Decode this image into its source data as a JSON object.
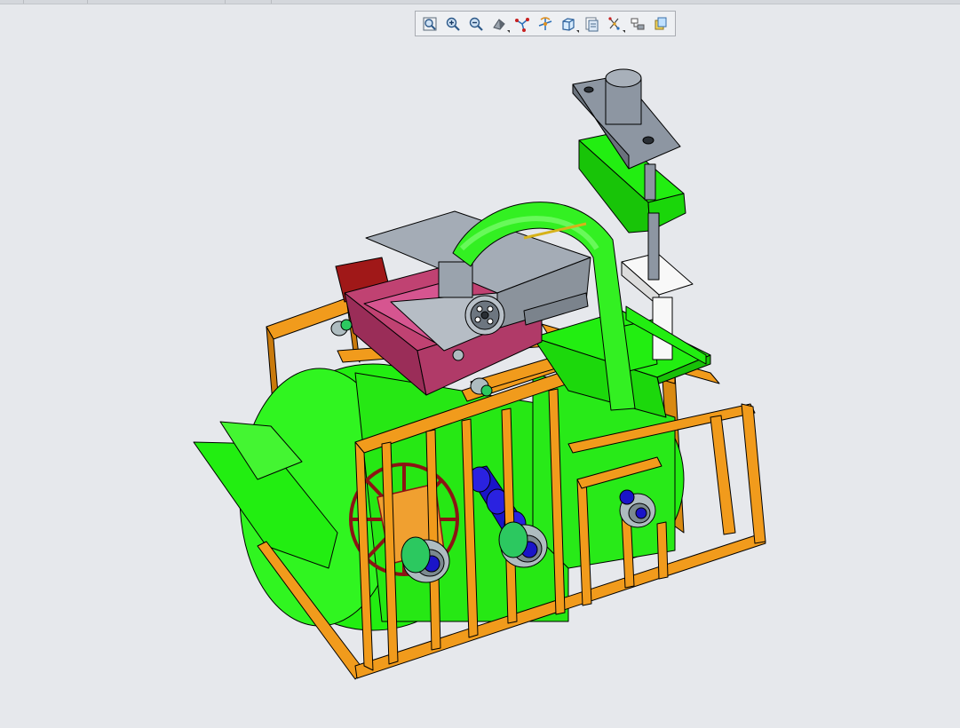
{
  "toolbar": {
    "buttons": [
      {
        "icon": "refit-icon"
      },
      {
        "icon": "zoom-in-icon"
      },
      {
        "icon": "zoom-out-icon"
      },
      {
        "icon": "display-style-icon"
      },
      {
        "icon": "datum-display-icon"
      },
      {
        "icon": "spin-center-icon"
      },
      {
        "icon": "saved-views-icon"
      },
      {
        "icon": "named-views-icon"
      },
      {
        "icon": "annotation-display-icon"
      },
      {
        "icon": "view-manager-icon"
      },
      {
        "icon": "appearance-icon"
      }
    ]
  },
  "colors": {
    "background": "#e6e8ec",
    "frame": "#f19b1c",
    "frame_edge": "#000000",
    "drum": "#22ee11",
    "pipe": "#33f022",
    "plate": "#a4acb6",
    "tray": "#c04272",
    "darkred": "#8c1414",
    "gear": "#1a14c8",
    "motor": "#8d96a2",
    "white_part": "#f8f8f8",
    "yellow": "#d6b21a"
  }
}
